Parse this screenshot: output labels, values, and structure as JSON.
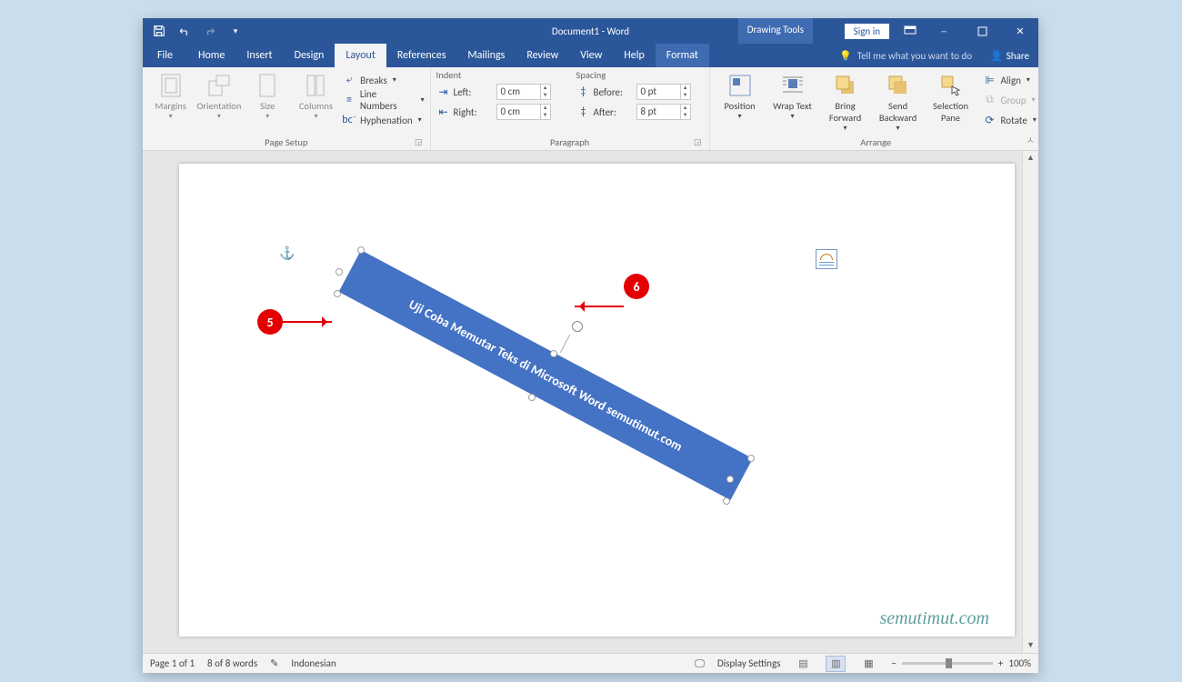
{
  "title": "Document1 - Word",
  "context_tab": "Drawing Tools",
  "signin": "Sign in",
  "tabs": {
    "file": "File",
    "home": "Home",
    "insert": "Insert",
    "design": "Design",
    "layout": "Layout",
    "references": "References",
    "mailings": "Mailings",
    "review": "Review",
    "view": "View",
    "help": "Help",
    "format": "Format"
  },
  "tellme": "Tell me what you want to do",
  "share": "Share",
  "ribbon": {
    "pagesetup": {
      "label": "Page Setup",
      "margins": "Margins",
      "orientation": "Orientation",
      "size": "Size",
      "columns": "Columns",
      "breaks": "Breaks",
      "linenumbers": "Line Numbers",
      "hyphenation": "Hyphenation"
    },
    "paragraph": {
      "label": "Paragraph",
      "indent_hdr": "Indent",
      "spacing_hdr": "Spacing",
      "left_lbl": "Left:",
      "right_lbl": "Right:",
      "before_lbl": "Before:",
      "after_lbl": "After:",
      "left": "0 cm",
      "right": "0 cm",
      "before": "0 pt",
      "after": "8 pt"
    },
    "arrange": {
      "label": "Arrange",
      "position": "Position",
      "wrap": "Wrap Text",
      "forward": "Bring Forward",
      "backward": "Send Backward",
      "selpane": "Selection Pane",
      "align": "Align",
      "group": "Group",
      "rotate": "Rotate"
    }
  },
  "shape_text": "Uji Coba Memutar Teks di Microsoft Word semutimut.com",
  "annotations": {
    "a": "5",
    "b": "6"
  },
  "watermark": "semutimut.com",
  "statusbar": {
    "page": "Page 1 of 1",
    "words": "8 of 8 words",
    "lang": "Indonesian",
    "display": "Display Settings",
    "zoom": "100%"
  }
}
